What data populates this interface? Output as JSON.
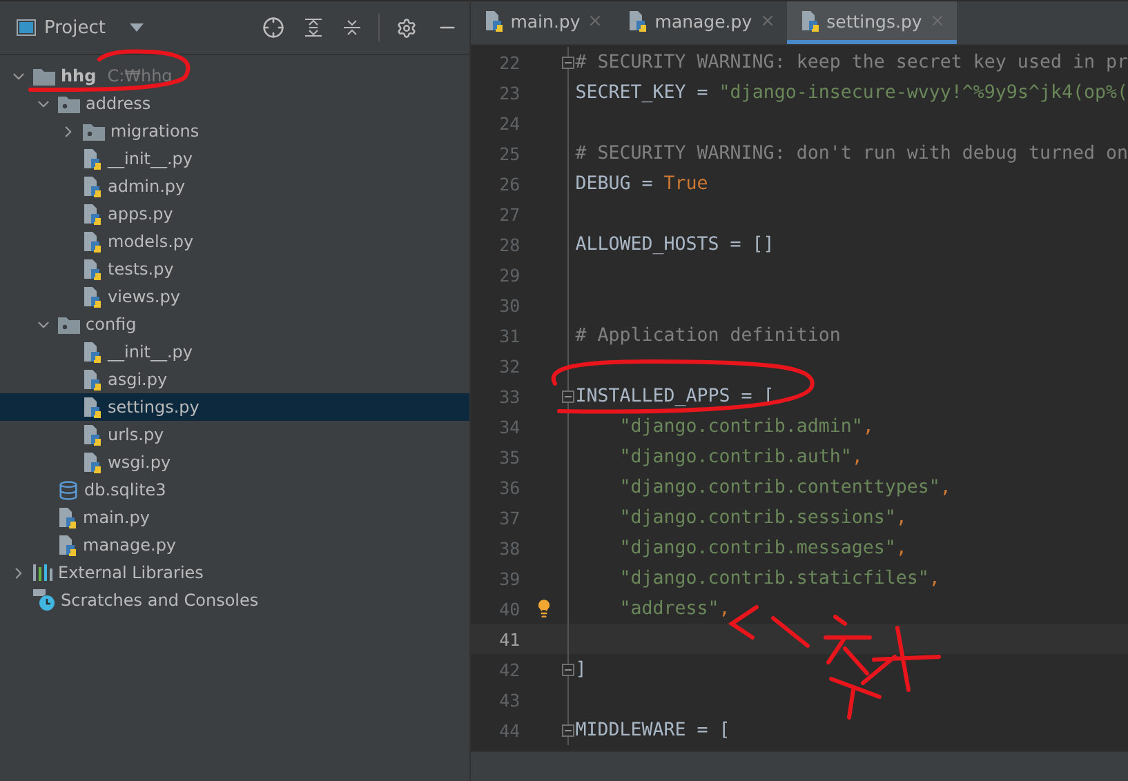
{
  "project_panel": {
    "title": "Project"
  },
  "tree": [
    {
      "label": "hhg",
      "hint": "C:₩hhg",
      "kind": "folder",
      "expanded": true,
      "selected": false,
      "children": [
        {
          "label": "address",
          "kind": "package",
          "expanded": true,
          "selected": false,
          "children": [
            {
              "label": "migrations",
              "kind": "package",
              "expanded": false,
              "selected": false
            },
            {
              "label": "__init__.py",
              "kind": "python",
              "selected": false
            },
            {
              "label": "admin.py",
              "kind": "python",
              "selected": false
            },
            {
              "label": "apps.py",
              "kind": "python",
              "selected": false
            },
            {
              "label": "models.py",
              "kind": "python",
              "selected": false
            },
            {
              "label": "tests.py",
              "kind": "python",
              "selected": false
            },
            {
              "label": "views.py",
              "kind": "python",
              "selected": false
            }
          ]
        },
        {
          "label": "config",
          "kind": "package",
          "expanded": true,
          "selected": false,
          "children": [
            {
              "label": "__init__.py",
              "kind": "python",
              "selected": false
            },
            {
              "label": "asgi.py",
              "kind": "python",
              "selected": false
            },
            {
              "label": "settings.py",
              "kind": "python",
              "selected": true
            },
            {
              "label": "urls.py",
              "kind": "python",
              "selected": false
            },
            {
              "label": "wsgi.py",
              "kind": "python",
              "selected": false
            }
          ]
        },
        {
          "label": "db.sqlite3",
          "kind": "database",
          "selected": false
        },
        {
          "label": "main.py",
          "kind": "python",
          "selected": false
        },
        {
          "label": "manage.py",
          "kind": "python",
          "selected": false
        }
      ]
    },
    {
      "label": "External Libraries",
      "kind": "libraries",
      "expanded": false,
      "selected": false
    },
    {
      "label": "Scratches and Consoles",
      "kind": "scratches",
      "selected": false
    }
  ],
  "tabs": [
    {
      "label": "main.py",
      "selected": false
    },
    {
      "label": "manage.py",
      "selected": false
    },
    {
      "label": "settings.py",
      "selected": true
    }
  ],
  "lines": [
    {
      "number": "22",
      "fold": true,
      "tokens": [
        {
          "kind": "comment",
          "text": "# SECURITY WARNING: keep the secret key used in pr"
        }
      ]
    },
    {
      "number": "23",
      "tokens": [
        {
          "kind": "plain",
          "text": "SECRET_KEY = "
        },
        {
          "kind": "string",
          "text": "\"django-insecure-wvyy!^%9y9s^jk4(op%("
        }
      ]
    },
    {
      "number": "24"
    },
    {
      "number": "25",
      "tokens": [
        {
          "kind": "comment",
          "text": "# SECURITY WARNING: don't run with debug turned on"
        }
      ]
    },
    {
      "number": "26",
      "tokens": [
        {
          "kind": "plain",
          "text": "DEBUG = "
        },
        {
          "kind": "keyword",
          "text": "True"
        }
      ]
    },
    {
      "number": "27"
    },
    {
      "number": "28",
      "tokens": [
        {
          "kind": "plain",
          "text": "ALLOWED_HOSTS = []"
        }
      ]
    },
    {
      "number": "29"
    },
    {
      "number": "30"
    },
    {
      "number": "31",
      "tokens": [
        {
          "kind": "comment",
          "text": "# Application definition"
        }
      ]
    },
    {
      "number": "32"
    },
    {
      "number": "33",
      "fold": true,
      "tokens": [
        {
          "kind": "plain",
          "text": "INSTALLED_APPS = ["
        }
      ]
    },
    {
      "number": "34",
      "tokens": [
        {
          "kind": "string",
          "text": "    \"django.contrib.admin\""
        },
        {
          "kind": "punct",
          "text": ","
        }
      ]
    },
    {
      "number": "35",
      "tokens": [
        {
          "kind": "string",
          "text": "    \"django.contrib.auth\""
        },
        {
          "kind": "punct",
          "text": ","
        }
      ]
    },
    {
      "number": "36",
      "tokens": [
        {
          "kind": "string",
          "text": "    \"django.contrib.contenttypes\""
        },
        {
          "kind": "punct",
          "text": ","
        }
      ]
    },
    {
      "number": "37",
      "tokens": [
        {
          "kind": "string",
          "text": "    \"django.contrib.sessions\""
        },
        {
          "kind": "punct",
          "text": ","
        }
      ]
    },
    {
      "number": "38",
      "tokens": [
        {
          "kind": "string",
          "text": "    \"django.contrib.messages\""
        },
        {
          "kind": "punct",
          "text": ","
        }
      ]
    },
    {
      "number": "39",
      "tokens": [
        {
          "kind": "string",
          "text": "    \"django.contrib.staticfiles\""
        },
        {
          "kind": "punct",
          "text": ","
        }
      ]
    },
    {
      "number": "40",
      "bulb": true,
      "tokens": [
        {
          "kind": "string",
          "text": "    \"address\""
        },
        {
          "kind": "punct",
          "text": ","
        }
      ]
    },
    {
      "number": "41",
      "current": true
    },
    {
      "number": "42",
      "fold": true,
      "tokens": [
        {
          "kind": "plain",
          "text": "]"
        }
      ]
    },
    {
      "number": "43"
    },
    {
      "number": "44",
      "fold": true,
      "tokens": [
        {
          "kind": "plain",
          "text": "MIDDLEWARE = ["
        }
      ]
    }
  ]
}
